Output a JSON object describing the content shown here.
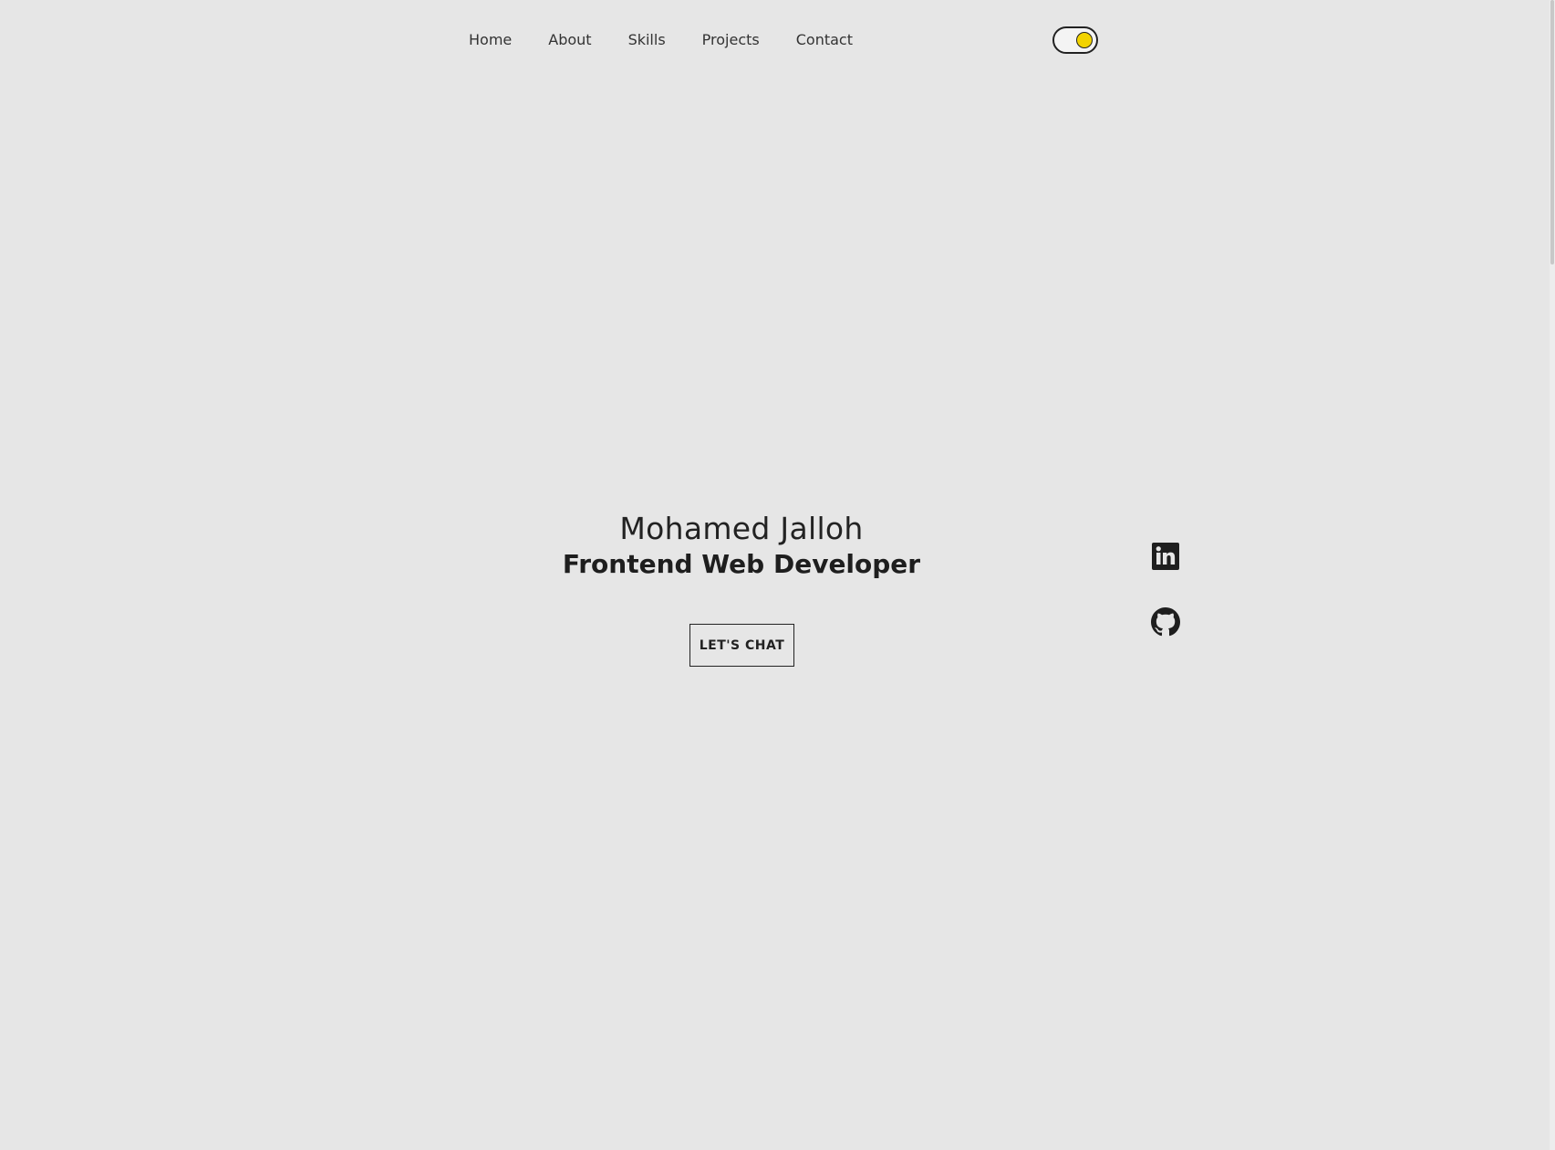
{
  "nav": {
    "items": [
      {
        "label": "Home"
      },
      {
        "label": "About"
      },
      {
        "label": "Skills"
      },
      {
        "label": "Projects"
      },
      {
        "label": "Contact"
      }
    ]
  },
  "theme_toggle": {
    "state": "light",
    "knob_color": "#f2d300"
  },
  "hero": {
    "name": "Mohamed Jalloh",
    "role": "Frontend Web Developer",
    "cta_label": "LET'S CHAT"
  },
  "social": {
    "items": [
      {
        "icon": "linkedin-icon"
      },
      {
        "icon": "github-icon"
      }
    ]
  },
  "colors": {
    "background": "#e6e6e6",
    "text": "#222222",
    "accent": "#f2d300"
  }
}
